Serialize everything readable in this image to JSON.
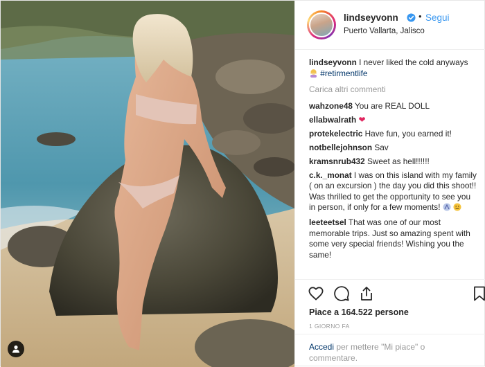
{
  "post": {
    "username": "lindseyvonn",
    "follow_label": "Segui",
    "separator": "•",
    "location": "Puerto Vallarta, Jalisco"
  },
  "caption": {
    "username": "lindseyvonn",
    "text": "I never liked the cold anyways",
    "hashtag": "#retirmentlife"
  },
  "load_more_label": "Carica altri commenti",
  "comments": [
    {
      "username": "wahzone48",
      "text": "You are REAL DOLL"
    },
    {
      "username": "ellabwalrath",
      "text": ""
    },
    {
      "username": "protekelectric",
      "text": "Have fun, you earned it!"
    },
    {
      "username": "notbellejohnson",
      "text": "Sav"
    },
    {
      "username": "kramsnrub432",
      "text": "Sweet as hell!!!!!!"
    },
    {
      "username": "c.k._monat",
      "text": "I was on this island with my family ( on an excursion ) the day you did this shoot!! Was thrilled to get the opportunity to see you in person, if only for a few moments!"
    },
    {
      "username": "leeteetsel",
      "text": "That was one of our most memorable trips. Just so amazing spent with some very special friends! Wishing you the same!"
    }
  ],
  "likes_label": "Piace a 164.522 persone",
  "timestamp": "1 GIORNO FA",
  "login": {
    "link": "Accedi",
    "text": "per mettere \"Mi piace\" o commentare."
  },
  "icons": {
    "verified": "verified-badge-icon",
    "like": "heart-icon",
    "comment": "comment-bubble-icon",
    "share": "share-icon",
    "save": "bookmark-icon",
    "user_tag": "user-tag-icon"
  },
  "colors": {
    "link_blue": "#3897f0",
    "hashtag_navy": "#003569",
    "muted_gray": "#999999"
  }
}
